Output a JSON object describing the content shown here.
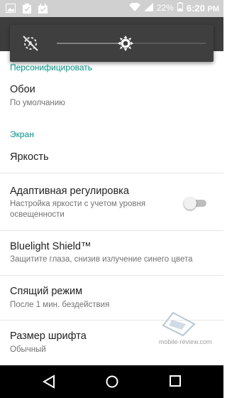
{
  "status_bar": {
    "battery_percent": "22%",
    "time": "6:20",
    "time_suffix": "PM"
  },
  "brightness": {
    "level": 0.46
  },
  "sections": [
    {
      "label": "Персонифицировать"
    },
    {
      "label": "Экран"
    }
  ],
  "items": [
    {
      "title": "Обои",
      "subtitle": "По умолчанию"
    },
    {
      "title": "Яркость"
    },
    {
      "title": "Адаптивная регулировка",
      "subtitle": "Настройка яркости с учетом уровня освещенности",
      "toggle": "off"
    },
    {
      "title": "Bluelight Shield™",
      "subtitle": "Защитите глаза, снизив излучение синего цвета"
    },
    {
      "title": "Спящий режим",
      "subtitle": "После 1 мин. бездействия"
    },
    {
      "title": "Размер шрифта",
      "subtitle": "Обычный"
    }
  ],
  "watermark": "mobile-review.com",
  "colors": {
    "accent": "#009688",
    "status_bar": "#d0d0d0",
    "panel": "#3f3f3f",
    "nav_bar": "#000000"
  }
}
